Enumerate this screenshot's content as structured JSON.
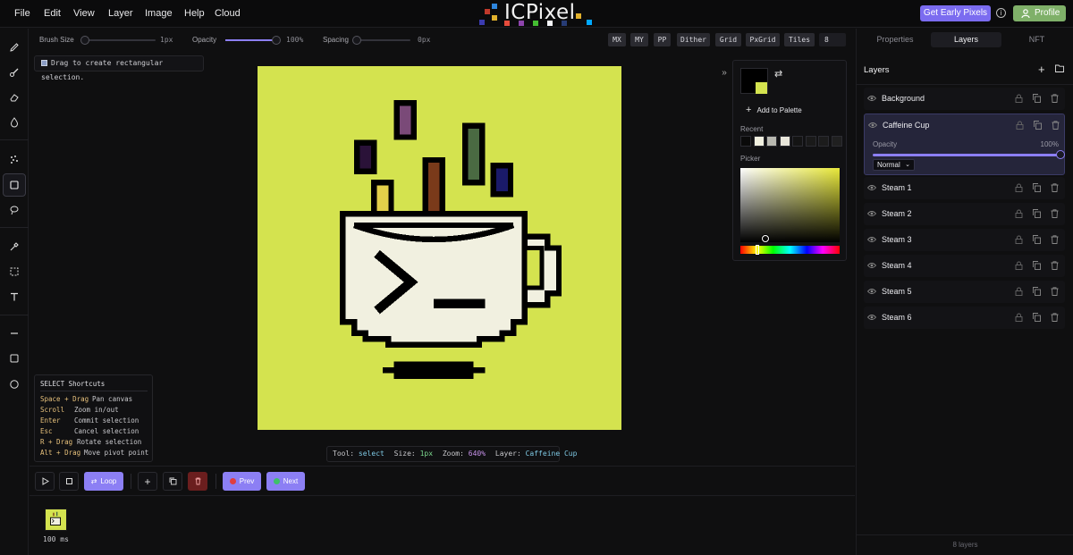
{
  "menubar": {
    "items": [
      "File",
      "Edit",
      "View",
      "Layer",
      "Image",
      "Help",
      "Cloud"
    ],
    "logo_text": "ICPixel",
    "cta_label": "Get Early Pixels",
    "info_icon": "info-icon",
    "profile_label": "Profile"
  },
  "toolbar": {
    "tools": [
      "pencil-icon",
      "brush-icon",
      "eraser-icon",
      "fill-icon",
      "spray-icon",
      "select-rect-icon",
      "lasso-icon",
      "eyedropper-icon",
      "marquee-icon",
      "text-icon",
      "line-icon",
      "rectangle-icon",
      "circle-icon"
    ],
    "active_tool": "select-rect-icon"
  },
  "options": {
    "brush_size_label": "Brush Size",
    "brush_size_value": "1px",
    "brush_size_level": 0.0,
    "opacity_label": "Opacity",
    "opacity_value": "100%",
    "opacity_level": 1.0,
    "spacing_label": "Spacing",
    "spacing_value": "0px",
    "spacing_level": 0.0,
    "toggles": [
      "MX",
      "MY",
      "PP",
      "Dither",
      "Grid",
      "PxGrid",
      "Tiles"
    ],
    "tile_count": "8"
  },
  "hint": "Drag to create rectangular selection.",
  "status": {
    "tool_label": "Tool:",
    "tool_value": "select",
    "size_label": "Size:",
    "size_value": "1px",
    "zoom_label": "Zoom:",
    "zoom_value": "640%",
    "layer_label": "Layer:",
    "layer_value": "Caffeine Cup"
  },
  "shortcuts": {
    "title": "SELECT Shortcuts",
    "rows": [
      {
        "key": "Space + Drag",
        "desc": "Pan canvas"
      },
      {
        "key": "Scroll",
        "desc": "Zoom in/out"
      },
      {
        "key": "Enter",
        "desc": "Commit selection"
      },
      {
        "key": "Esc",
        "desc": "Cancel selection"
      },
      {
        "key": "R + Drag",
        "desc": "Rotate selection"
      },
      {
        "key": "Alt + Drag",
        "desc": "Move pivot point"
      }
    ]
  },
  "picker": {
    "swap_icon": "swap-icon",
    "add_to_palette": "Add to Palette",
    "recent_label": "Recent",
    "picker_label": "Picker",
    "primary_color": "#000000",
    "secondary_color": "#d4e34f",
    "recent_colors": [
      "#0a0a0a",
      "#f1f0e0",
      "#b8b8b0",
      "#e8e6da",
      "#141414",
      "#1a1a1a",
      "#1c1c1c",
      "#202020"
    ]
  },
  "timeline": {
    "loop_label": "Loop",
    "prev_label": "Prev",
    "next_label": "Next",
    "frame_time": "100 ms"
  },
  "right_panel": {
    "tabs": [
      "Properties",
      "Layers",
      "NFT"
    ],
    "active_tab": "Layers",
    "layers_title": "Layers",
    "layers": [
      {
        "name": "Background"
      },
      {
        "name": "Caffeine Cup",
        "active": true
      },
      {
        "name": "Steam 1"
      },
      {
        "name": "Steam 2"
      },
      {
        "name": "Steam 3"
      },
      {
        "name": "Steam 4"
      },
      {
        "name": "Steam 5"
      },
      {
        "name": "Steam 6"
      }
    ],
    "opacity_label": "Opacity",
    "opacity_value": "100%",
    "blend_mode": "Normal",
    "layer_count": "8 layers"
  },
  "colors": {
    "accent": "#8c7ff4",
    "canvas_bg": "#d4e34f",
    "profile_green": "#7fb069",
    "steam": [
      "#7a4a78",
      "#2a1238",
      "#e3d04a",
      "#7a3a1a",
      "#4a6a42",
      "#1a1a6a"
    ]
  }
}
